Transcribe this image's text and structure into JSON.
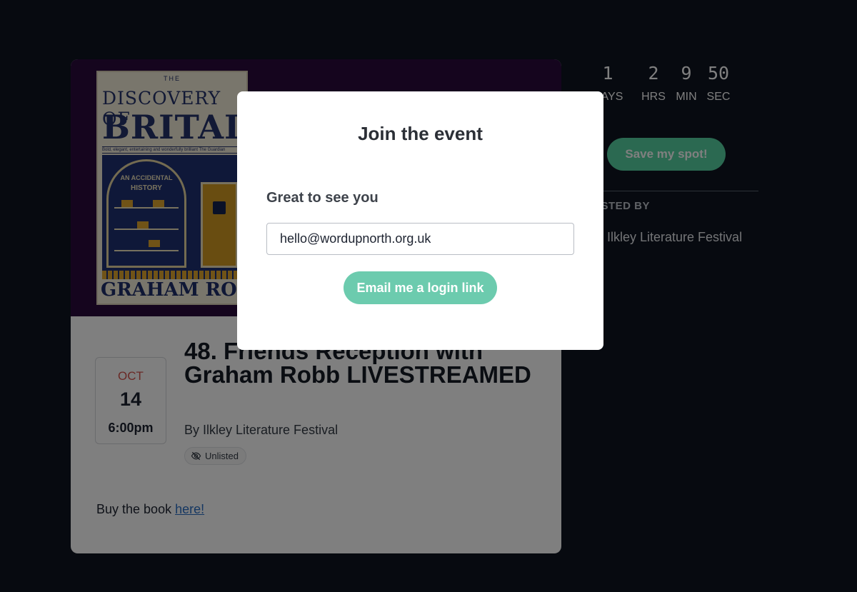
{
  "book_cover": {
    "top_label": "THE",
    "title_line1": "DISCOVERY OF",
    "title_line2": "BRITAIN",
    "tagline": "Bold, elegant, entertaining and wonderfully brilliant   The Guardian",
    "arch_line1": "AN ACCIDENTAL",
    "arch_line2": "HISTORY",
    "author": "GRAHAM ROBB"
  },
  "event": {
    "month": "OCT",
    "day": "14",
    "time": "6:00pm",
    "title": "48. Friends Reception with Graham Robb LIVESTREAMED",
    "host_line": "By Ilkley Literature Festival",
    "visibility_badge": "Unlisted",
    "buy_text": "Buy the book ",
    "buy_link_text": "here!"
  },
  "countdown": [
    {
      "value": "1",
      "label": "DAYS"
    },
    {
      "value": "2",
      "label": "HRS"
    },
    {
      "value": "9",
      "label": "MIN"
    },
    {
      "value": "50",
      "label": "SEC"
    }
  ],
  "sidebar": {
    "save_button": "Save my spot!",
    "hosted_by_label": "HOSTED BY",
    "host_name": "Ilkley Literature Festival"
  },
  "modal": {
    "title": "Join the event",
    "greeting": "Great to see you",
    "email_value": "hello@wordupnorth.org.uk",
    "submit_button": "Email me a login link"
  },
  "colors": {
    "page_background": "#0e1420",
    "cover_band": "#2a0a3c",
    "accent_green": "#6ccbae",
    "month_red": "#d5544d",
    "link_blue": "#2b6fc4"
  },
  "icons": {
    "unlisted": "eye-slash-icon"
  }
}
